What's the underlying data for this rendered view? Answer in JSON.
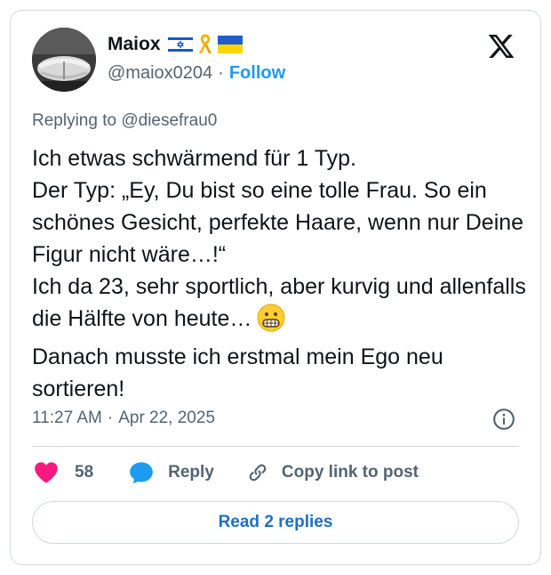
{
  "author": {
    "display_name": "Maiox",
    "flag_icons": [
      "israel-flag-icon",
      "yellow-ribbon-icon",
      "ukraine-flag-icon"
    ],
    "handle": "@maiox0204",
    "separator": "·",
    "follow_label": "Follow"
  },
  "reply_context": "Replying to @diesefrau0",
  "tweet": {
    "text": "Ich etwas schwärmend für 1 Typ.\nDer Typ: „Ey, Du bist so eine tolle Frau. So ein schönes Gesicht, perfekte Haare, wenn nur Deine Figur nicht wäre…!“\nIch da 23, sehr sportlich, aber kurvig und allenfalls die Hälfte von heute…",
    "text_after": "Danach musste ich erstmal mein Ego neu sortieren!",
    "emoji": "grimacing-face-icon"
  },
  "meta": {
    "time": "11:27 AM",
    "separator": "·",
    "date": "Apr 22, 2025"
  },
  "actions": {
    "like_count": "58",
    "reply_label": "Reply",
    "copy_label": "Copy link to post"
  },
  "read_replies_label": "Read 2 replies",
  "colors": {
    "like": "#f91880",
    "reply": "#1d9bf0",
    "link": "#1d9bf0",
    "read_replies_text": "#1d6fc4",
    "secondary_text": "#536471",
    "border": "#cfd9de"
  }
}
